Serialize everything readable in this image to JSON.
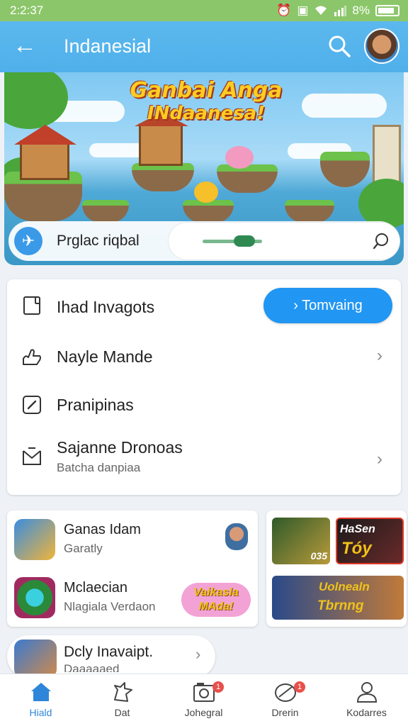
{
  "status_bar": {
    "time": "2:2:37",
    "battery": "8%"
  },
  "app_bar": {
    "title": "Indanesial"
  },
  "banner": {
    "title_line1": "Ganbai Anga",
    "title_line2": "INdaanesa!",
    "pill_label": "Prglac riqbal"
  },
  "menu": {
    "items": [
      {
        "label": "Ihad Invagots",
        "button": "Tomvaing"
      },
      {
        "label": "Nayle Mande"
      },
      {
        "label": "Pranipinas"
      },
      {
        "label": "Sajanne Dronoas",
        "sub": "Batcha danpiaa"
      }
    ]
  },
  "games": [
    {
      "title": "Ganas Idam",
      "sub": "Garatly"
    },
    {
      "title": "Mclaecian",
      "sub": "Nlagiala Verdaon",
      "badge": "Vaikasla MAda!"
    }
  ],
  "promos": [
    {
      "label": "035"
    },
    {
      "label_top": "HaSen",
      "label_bottom": "Tóy"
    },
    {
      "label_top": "Uolnealn",
      "label_bottom": "Tbrnng"
    }
  ],
  "daily": {
    "title": "Dcly Inavaipt.",
    "sub": "Daaaaaed"
  },
  "bottom_nav": [
    {
      "label": "Hiald"
    },
    {
      "label": "Dat"
    },
    {
      "label": "Johegral",
      "badge": "1"
    },
    {
      "label": "Drerin",
      "badge": "1"
    },
    {
      "label": "Kodarres"
    }
  ],
  "colors": {
    "accent": "#2196f3",
    "app_bar": "#4fb0ea",
    "status_bar": "#8cc66a",
    "badge": "#e8504a"
  }
}
